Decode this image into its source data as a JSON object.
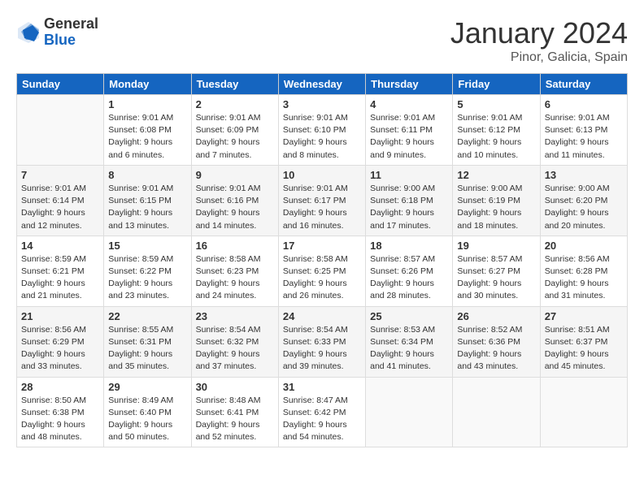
{
  "header": {
    "logo_general": "General",
    "logo_blue": "Blue",
    "month": "January 2024",
    "location": "Pinor, Galicia, Spain"
  },
  "weekdays": [
    "Sunday",
    "Monday",
    "Tuesday",
    "Wednesday",
    "Thursday",
    "Friday",
    "Saturday"
  ],
  "weeks": [
    [
      {
        "day": "",
        "empty": true
      },
      {
        "day": "1",
        "sunrise": "Sunrise: 9:01 AM",
        "sunset": "Sunset: 6:08 PM",
        "daylight": "Daylight: 9 hours and 6 minutes."
      },
      {
        "day": "2",
        "sunrise": "Sunrise: 9:01 AM",
        "sunset": "Sunset: 6:09 PM",
        "daylight": "Daylight: 9 hours and 7 minutes."
      },
      {
        "day": "3",
        "sunrise": "Sunrise: 9:01 AM",
        "sunset": "Sunset: 6:10 PM",
        "daylight": "Daylight: 9 hours and 8 minutes."
      },
      {
        "day": "4",
        "sunrise": "Sunrise: 9:01 AM",
        "sunset": "Sunset: 6:11 PM",
        "daylight": "Daylight: 9 hours and 9 minutes."
      },
      {
        "day": "5",
        "sunrise": "Sunrise: 9:01 AM",
        "sunset": "Sunset: 6:12 PM",
        "daylight": "Daylight: 9 hours and 10 minutes."
      },
      {
        "day": "6",
        "sunrise": "Sunrise: 9:01 AM",
        "sunset": "Sunset: 6:13 PM",
        "daylight": "Daylight: 9 hours and 11 minutes."
      }
    ],
    [
      {
        "day": "7",
        "sunrise": "Sunrise: 9:01 AM",
        "sunset": "Sunset: 6:14 PM",
        "daylight": "Daylight: 9 hours and 12 minutes."
      },
      {
        "day": "8",
        "sunrise": "Sunrise: 9:01 AM",
        "sunset": "Sunset: 6:15 PM",
        "daylight": "Daylight: 9 hours and 13 minutes."
      },
      {
        "day": "9",
        "sunrise": "Sunrise: 9:01 AM",
        "sunset": "Sunset: 6:16 PM",
        "daylight": "Daylight: 9 hours and 14 minutes."
      },
      {
        "day": "10",
        "sunrise": "Sunrise: 9:01 AM",
        "sunset": "Sunset: 6:17 PM",
        "daylight": "Daylight: 9 hours and 16 minutes."
      },
      {
        "day": "11",
        "sunrise": "Sunrise: 9:00 AM",
        "sunset": "Sunset: 6:18 PM",
        "daylight": "Daylight: 9 hours and 17 minutes."
      },
      {
        "day": "12",
        "sunrise": "Sunrise: 9:00 AM",
        "sunset": "Sunset: 6:19 PM",
        "daylight": "Daylight: 9 hours and 18 minutes."
      },
      {
        "day": "13",
        "sunrise": "Sunrise: 9:00 AM",
        "sunset": "Sunset: 6:20 PM",
        "daylight": "Daylight: 9 hours and 20 minutes."
      }
    ],
    [
      {
        "day": "14",
        "sunrise": "Sunrise: 8:59 AM",
        "sunset": "Sunset: 6:21 PM",
        "daylight": "Daylight: 9 hours and 21 minutes."
      },
      {
        "day": "15",
        "sunrise": "Sunrise: 8:59 AM",
        "sunset": "Sunset: 6:22 PM",
        "daylight": "Daylight: 9 hours and 23 minutes."
      },
      {
        "day": "16",
        "sunrise": "Sunrise: 8:58 AM",
        "sunset": "Sunset: 6:23 PM",
        "daylight": "Daylight: 9 hours and 24 minutes."
      },
      {
        "day": "17",
        "sunrise": "Sunrise: 8:58 AM",
        "sunset": "Sunset: 6:25 PM",
        "daylight": "Daylight: 9 hours and 26 minutes."
      },
      {
        "day": "18",
        "sunrise": "Sunrise: 8:57 AM",
        "sunset": "Sunset: 6:26 PM",
        "daylight": "Daylight: 9 hours and 28 minutes."
      },
      {
        "day": "19",
        "sunrise": "Sunrise: 8:57 AM",
        "sunset": "Sunset: 6:27 PM",
        "daylight": "Daylight: 9 hours and 30 minutes."
      },
      {
        "day": "20",
        "sunrise": "Sunrise: 8:56 AM",
        "sunset": "Sunset: 6:28 PM",
        "daylight": "Daylight: 9 hours and 31 minutes."
      }
    ],
    [
      {
        "day": "21",
        "sunrise": "Sunrise: 8:56 AM",
        "sunset": "Sunset: 6:29 PM",
        "daylight": "Daylight: 9 hours and 33 minutes."
      },
      {
        "day": "22",
        "sunrise": "Sunrise: 8:55 AM",
        "sunset": "Sunset: 6:31 PM",
        "daylight": "Daylight: 9 hours and 35 minutes."
      },
      {
        "day": "23",
        "sunrise": "Sunrise: 8:54 AM",
        "sunset": "Sunset: 6:32 PM",
        "daylight": "Daylight: 9 hours and 37 minutes."
      },
      {
        "day": "24",
        "sunrise": "Sunrise: 8:54 AM",
        "sunset": "Sunset: 6:33 PM",
        "daylight": "Daylight: 9 hours and 39 minutes."
      },
      {
        "day": "25",
        "sunrise": "Sunrise: 8:53 AM",
        "sunset": "Sunset: 6:34 PM",
        "daylight": "Daylight: 9 hours and 41 minutes."
      },
      {
        "day": "26",
        "sunrise": "Sunrise: 8:52 AM",
        "sunset": "Sunset: 6:36 PM",
        "daylight": "Daylight: 9 hours and 43 minutes."
      },
      {
        "day": "27",
        "sunrise": "Sunrise: 8:51 AM",
        "sunset": "Sunset: 6:37 PM",
        "daylight": "Daylight: 9 hours and 45 minutes."
      }
    ],
    [
      {
        "day": "28",
        "sunrise": "Sunrise: 8:50 AM",
        "sunset": "Sunset: 6:38 PM",
        "daylight": "Daylight: 9 hours and 48 minutes."
      },
      {
        "day": "29",
        "sunrise": "Sunrise: 8:49 AM",
        "sunset": "Sunset: 6:40 PM",
        "daylight": "Daylight: 9 hours and 50 minutes."
      },
      {
        "day": "30",
        "sunrise": "Sunrise: 8:48 AM",
        "sunset": "Sunset: 6:41 PM",
        "daylight": "Daylight: 9 hours and 52 minutes."
      },
      {
        "day": "31",
        "sunrise": "Sunrise: 8:47 AM",
        "sunset": "Sunset: 6:42 PM",
        "daylight": "Daylight: 9 hours and 54 minutes."
      },
      {
        "day": "",
        "empty": true
      },
      {
        "day": "",
        "empty": true
      },
      {
        "day": "",
        "empty": true
      }
    ]
  ]
}
